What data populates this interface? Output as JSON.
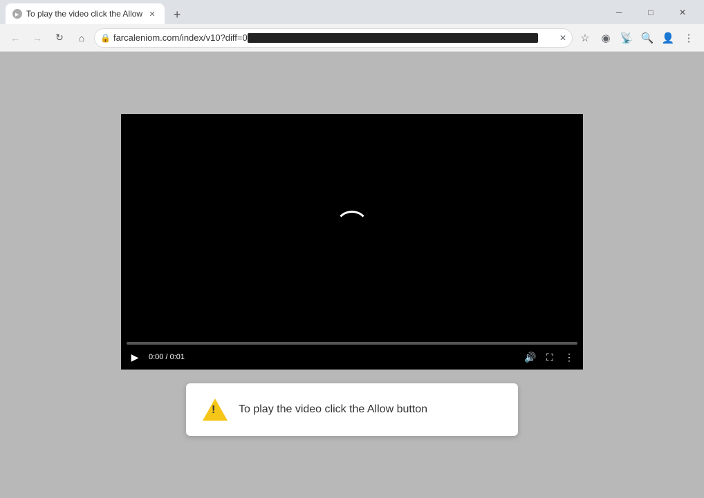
{
  "window": {
    "title": "To play the video click the Allow",
    "url_display": "farcaleniom.com/index/v10?diff=0",
    "url_full": "farcaleniom.com/index/v10?diff=0"
  },
  "toolbar": {
    "back_label": "←",
    "forward_label": "→",
    "reload_label": "↻",
    "home_label": "⌂",
    "new_tab_label": "+",
    "minimize_label": "─",
    "maximize_label": "□",
    "close_label": "✕"
  },
  "video": {
    "time_current": "0:00",
    "time_total": "0:01",
    "time_display": "0:00 / 0:01"
  },
  "notification": {
    "message": "To play the video click the Allow button"
  }
}
